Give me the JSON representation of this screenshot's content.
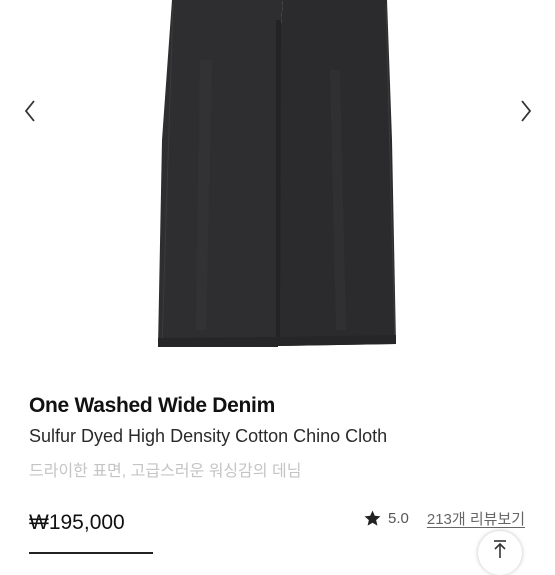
{
  "gallery": {
    "image_alt": "Black wide denim pants",
    "prev_icon": "chevron-left-icon",
    "next_icon": "chevron-right-icon"
  },
  "product": {
    "name": "One Washed Wide Denim",
    "subtitle": "Sulfur Dyed High Density Cotton Chino Cloth",
    "description": "드라이한 표면, 고급스러운 워싱감의 데님",
    "price": "₩195,000"
  },
  "rating": {
    "icon": "star-icon",
    "score": "5.0",
    "review_link": "213개 리뷰보기"
  },
  "actions": {
    "scroll_top_icon": "arrow-up-to-top-icon"
  },
  "colors": {
    "denim": "#2e2e30",
    "text_primary": "#111111",
    "text_muted": "#c4c4c4"
  }
}
